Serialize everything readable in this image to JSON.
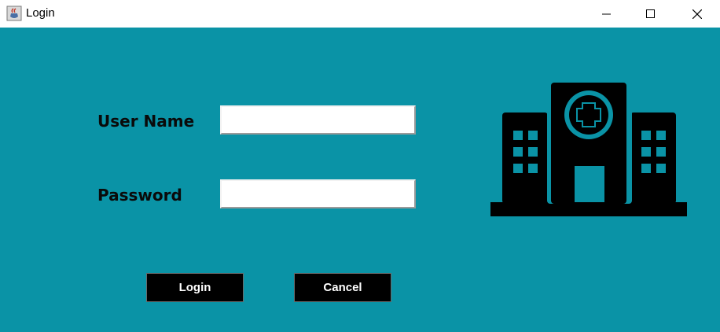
{
  "window": {
    "title": "Login",
    "app_icon": "java-coffee-icon",
    "controls": [
      "minimize-icon",
      "maximize-icon",
      "close-icon"
    ]
  },
  "form": {
    "username_label": "User Name",
    "username_value": "",
    "password_label": "Password",
    "password_value": ""
  },
  "buttons": {
    "login": "Login",
    "cancel": "Cancel"
  },
  "illustration": {
    "icon": "hospital-building-icon"
  },
  "colors": {
    "background": "#0a93a6",
    "button_bg": "#000000",
    "button_text": "#ffffff",
    "icon": "#000000"
  }
}
